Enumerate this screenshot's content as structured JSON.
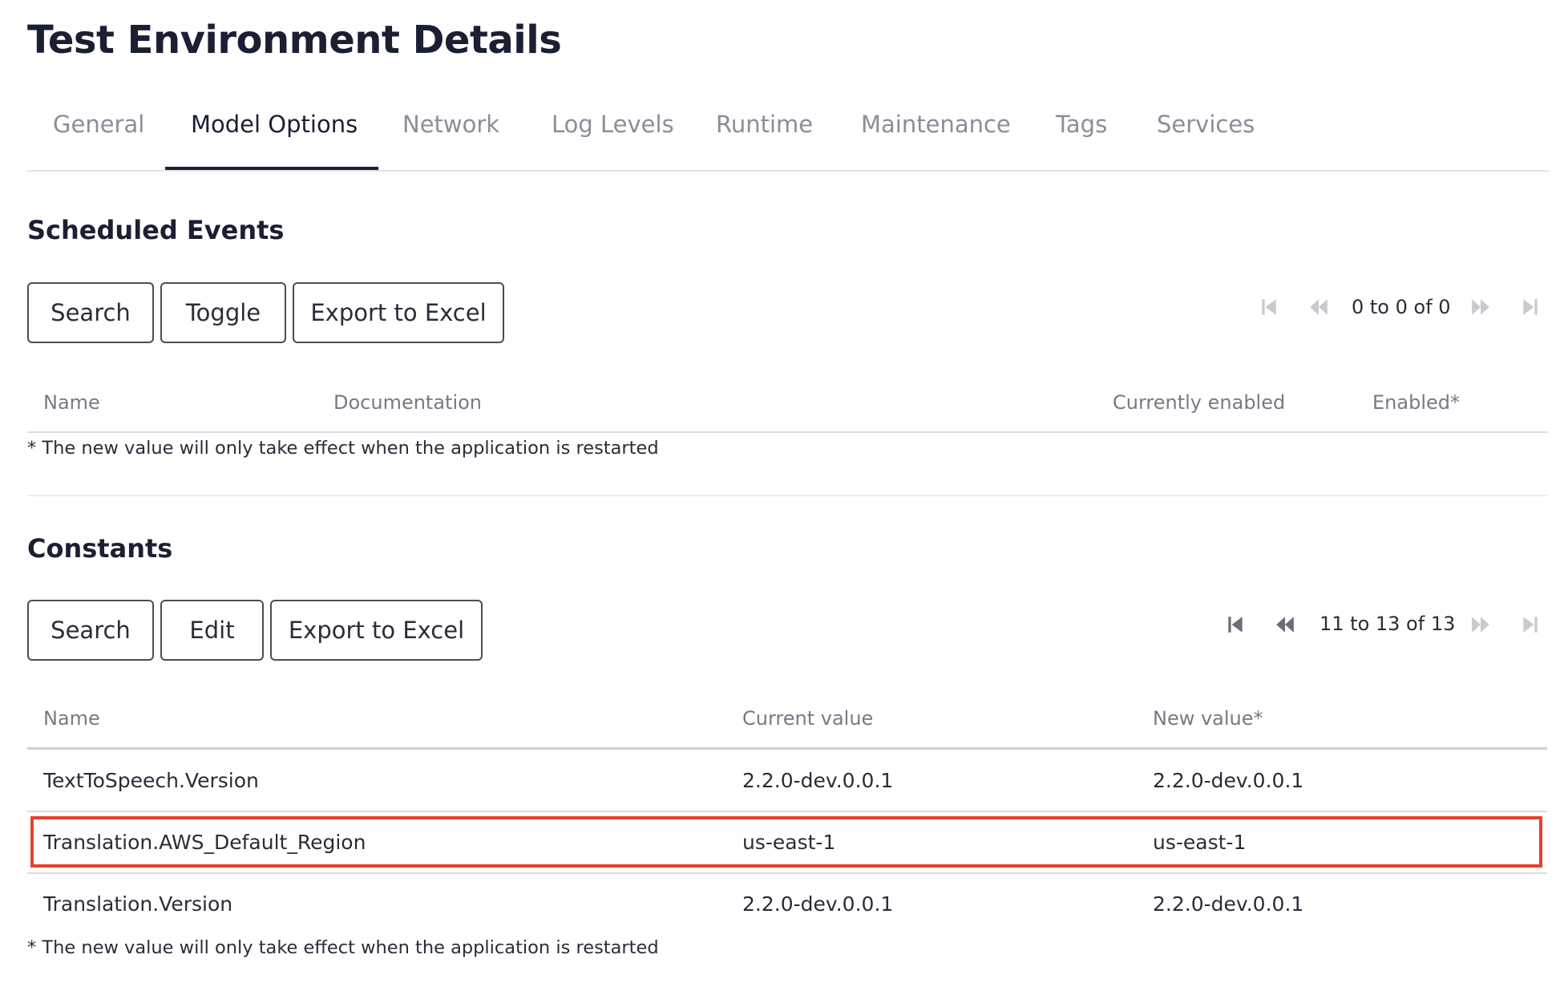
{
  "page": {
    "title": "Test Environment Details"
  },
  "tabs": [
    {
      "label": "General",
      "active": false
    },
    {
      "label": "Model Options",
      "active": true
    },
    {
      "label": "Network",
      "active": false
    },
    {
      "label": "Log Levels",
      "active": false
    },
    {
      "label": "Runtime",
      "active": false
    },
    {
      "label": "Maintenance",
      "active": false
    },
    {
      "label": "Tags",
      "active": false
    },
    {
      "label": "Services",
      "active": false
    }
  ],
  "scheduled_events": {
    "title": "Scheduled Events",
    "buttons": {
      "search": "Search",
      "toggle": "Toggle",
      "export": "Export to Excel"
    },
    "pager": {
      "text": "0 to 0 of 0"
    },
    "columns": {
      "name": "Name",
      "documentation": "Documentation",
      "currently_enabled": "Currently enabled",
      "enabled": "Enabled*"
    },
    "note": "* The new value will only take effect when the application is restarted"
  },
  "constants": {
    "title": "Constants",
    "buttons": {
      "search": "Search",
      "edit": "Edit",
      "export": "Export to Excel"
    },
    "pager": {
      "text": "11 to 13 of 13"
    },
    "columns": {
      "name": "Name",
      "current_value": "Current value",
      "new_value": "New value*"
    },
    "rows": [
      {
        "name": "TextToSpeech.Version",
        "current_value": "2.2.0-dev.0.0.1",
        "new_value": "2.2.0-dev.0.0.1"
      },
      {
        "name": "Translation.AWS_Default_Region",
        "current_value": "us-east-1",
        "new_value": "us-east-1",
        "highlighted": true
      },
      {
        "name": "Translation.Version",
        "current_value": "2.2.0-dev.0.0.1",
        "new_value": "2.2.0-dev.0.0.1"
      }
    ],
    "note": "* The new value will only take effect when the application is restarted"
  },
  "colors": {
    "highlight": "#e5412d",
    "text_dark": "#1b1f33",
    "text_muted": "#8b8d99"
  }
}
